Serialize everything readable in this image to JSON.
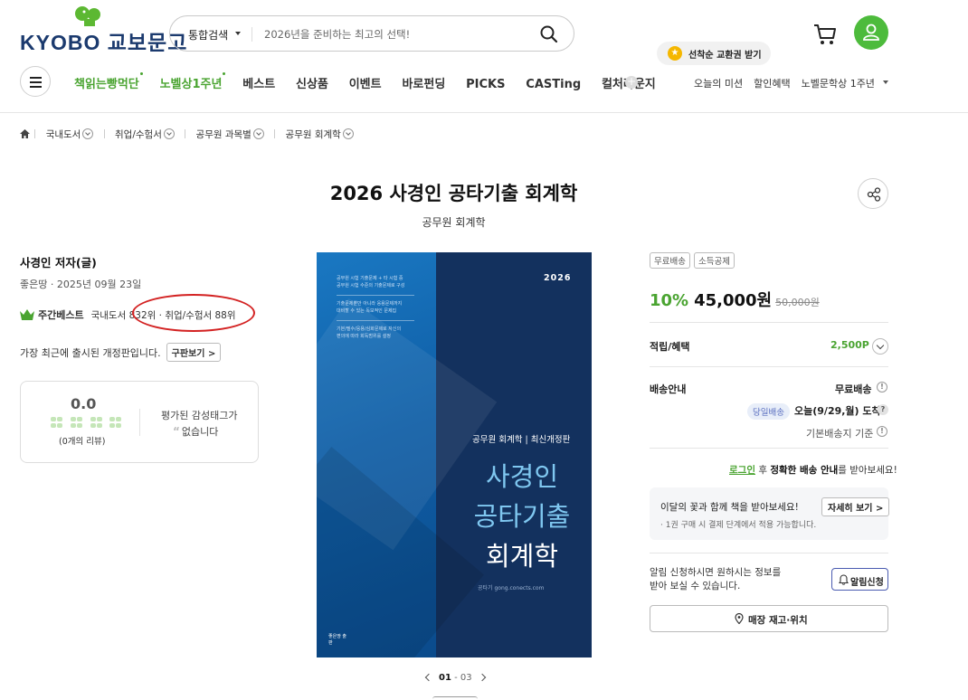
{
  "header": {
    "logo_text": "KYOBO 교보문고",
    "search": {
      "category": "통합검색",
      "placeholder": "2026년을 준비하는 최고의 선택!"
    },
    "event_bubble": "선착순 교환권 받기"
  },
  "nav": {
    "items": [
      {
        "label": "책읽는빵먹단",
        "highlight": true
      },
      {
        "label": "노벨상1주년",
        "highlight": true
      },
      {
        "label": "베스트",
        "highlight": false
      },
      {
        "label": "신상품",
        "highlight": false
      },
      {
        "label": "이벤트",
        "highlight": false
      },
      {
        "label": "바로펀딩",
        "highlight": false
      },
      {
        "label": "PICKS",
        "highlight": false
      },
      {
        "label": "CASTing",
        "highlight": false
      },
      {
        "label": "컬처라운지",
        "highlight": false
      }
    ],
    "right": {
      "mission": "오늘의 미션",
      "discount": "할인혜택",
      "nobel": "노벨문학상 1주년"
    }
  },
  "breadcrumb": [
    "국내도서",
    "취업/수험서",
    "공무원 과목별",
    "공무원 회계학"
  ],
  "product": {
    "title": "2026 사경인 공타기출 회계학",
    "subtitle": "공무원 회계학",
    "author": "사경인 저자(글)",
    "publisher_date": "좋은땅 · 2025년 09월 23일",
    "best_label": "주간베스트",
    "rank_domestic": "국내도서 832위",
    "rank_sep": " · ",
    "rank_category": "취업/수험서 88위",
    "revision_note": "가장 최근에 출시된 개정판입니다.",
    "old_edition_btn": "구판보기 >",
    "review": {
      "score": "0.0",
      "count_text": "(0개의 리뷰)",
      "tag_line1": "평가된 감성태그가",
      "tag_line2": "없습니다"
    }
  },
  "cover": {
    "year": "2026",
    "bullets": [
      "공무원 시험 기출문제 + 타 시험 중",
      "공무원 시험 수준의 기출문제로 구성",
      "기출문제뿐만 아니라 응용문제까지",
      "대비할 수 있는 독보적인 문제집",
      "기본/필수/응용/심화문제로 자신의",
      "편의에 따라 회독범위를 설정"
    ],
    "series": "공무원 회계학 | 최신개정판",
    "main_line1": "사경인",
    "main_line2": "공타기출",
    "main_line3": "회계학",
    "author_line": "공타기  gong.conects.com",
    "publisher": "좋은땅 출판"
  },
  "pager": {
    "current": "01",
    "total": "03"
  },
  "purchase": {
    "badges": [
      "무료배송",
      "소득공제"
    ],
    "discount_pct": "10%",
    "sale_price": "45,000원",
    "original_price": "50,000원",
    "benefit_label": "적립/혜택",
    "benefit_value": "2,500P",
    "shipping_label": "배송안내",
    "shipping_free": "무료배송",
    "today_badge": "당일배송",
    "today_text": "오늘(9/29,월) 도착",
    "basic_ship": "기본배송지 기준",
    "login_link": "로그인",
    "login_mid": " 후 ",
    "login_bold": "정확한 배송 안내",
    "login_tail": "를 받아보세요!",
    "flower_title": "이달의 꽃과 함께 책을 받아보세요!",
    "flower_sub": "· 1권 구매 시 결제 단계에서 적용 가능합니다.",
    "flower_btn": "자세히 보기 >",
    "alarm_line1": "알림 신청하시면 원하시는 정보를",
    "alarm_line2": "받아 보실 수 있습니다.",
    "alarm_btn": "알림신청",
    "store_btn": "매장 재고·위치"
  },
  "colors": {
    "brand_green": "#4aa431",
    "brand_navy": "#1b3a6e",
    "highlight_red": "#d32222"
  }
}
